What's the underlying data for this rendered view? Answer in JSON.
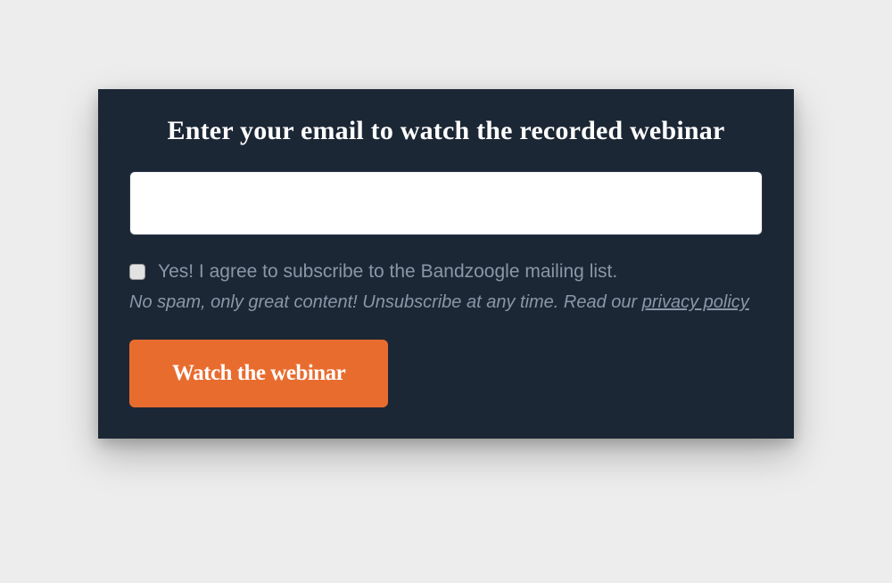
{
  "form": {
    "heading": "Enter your email to watch the recorded webinar",
    "email_value": "",
    "consent_label": "Yes! I agree to subscribe to the Bandzoogle mailing list.",
    "subtext_prefix": "No spam, only great content! Unsubscribe at any time. Read our ",
    "privacy_link_label": "privacy policy",
    "submit_label": "Watch the webinar"
  }
}
